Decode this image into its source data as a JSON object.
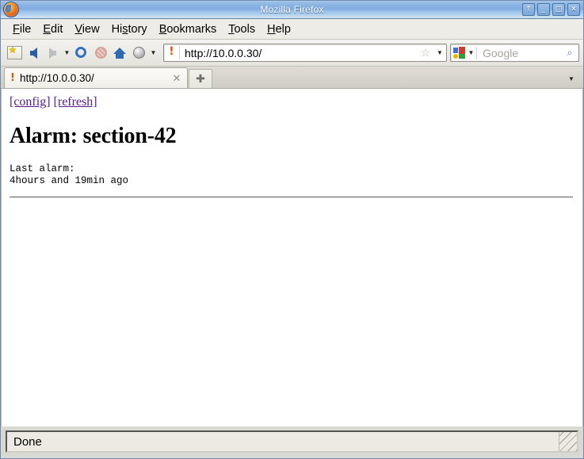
{
  "window": {
    "title": "Mozilla Firefox",
    "logo_icon": "firefox-logo-icon",
    "buttons": [
      {
        "name": "shade-button",
        "glyph": "↑"
      },
      {
        "name": "minimize-button",
        "glyph": "_"
      },
      {
        "name": "maximize-button",
        "glyph": "□"
      },
      {
        "name": "close-button",
        "glyph": "✕"
      }
    ]
  },
  "menubar": {
    "items": [
      {
        "pre": "",
        "accel": "F",
        "post": "ile"
      },
      {
        "pre": "",
        "accel": "E",
        "post": "dit"
      },
      {
        "pre": "",
        "accel": "V",
        "post": "iew"
      },
      {
        "pre": "Hi",
        "accel": "s",
        "post": "tory"
      },
      {
        "pre": "",
        "accel": "B",
        "post": "ookmarks"
      },
      {
        "pre": "",
        "accel": "T",
        "post": "ools"
      },
      {
        "pre": "",
        "accel": "H",
        "post": "elp"
      }
    ]
  },
  "toolbar": {
    "bookmark_page_icon": "bookmark-page-icon",
    "back_icon": "back-arrow-icon",
    "forward_icon": "forward-arrow-icon",
    "nav_dropdown_glyph": "▼",
    "reload_icon": "reload-icon",
    "stop_icon": "stop-icon",
    "home_icon": "home-icon",
    "globe_icon": "globe-icon",
    "globe_dropdown_glyph": "▼",
    "url": {
      "favicon_glyph": "!",
      "value": "http://10.0.0.30/",
      "star_glyph": "☆",
      "dropdown_glyph": "▼"
    },
    "search": {
      "engine_icon": "google-logo-icon",
      "engine_dropdown_glyph": "▼",
      "placeholder": "Google",
      "magnifier_glyph": "⌕"
    }
  },
  "tabbar": {
    "tabs": [
      {
        "favicon_glyph": "!",
        "label": "http://10.0.0.30/",
        "close_glyph": "✕"
      }
    ],
    "new_tab_glyph": "✚",
    "tablist_glyph": "▼"
  },
  "page": {
    "links": [
      {
        "label": "[config]"
      },
      {
        "label": "[refresh]"
      }
    ],
    "heading": "Alarm: section-42",
    "pre_text": "Last alarm:\n4hours and 19min ago"
  },
  "statusbar": {
    "text": "Done",
    "grip_icon": "resize-grip-icon"
  },
  "colors": {
    "titlebar_blue": "#7fade0",
    "link_purple": "#551a8b",
    "favicon_orange": "#e8520c",
    "chrome_gray": "#edece6"
  }
}
